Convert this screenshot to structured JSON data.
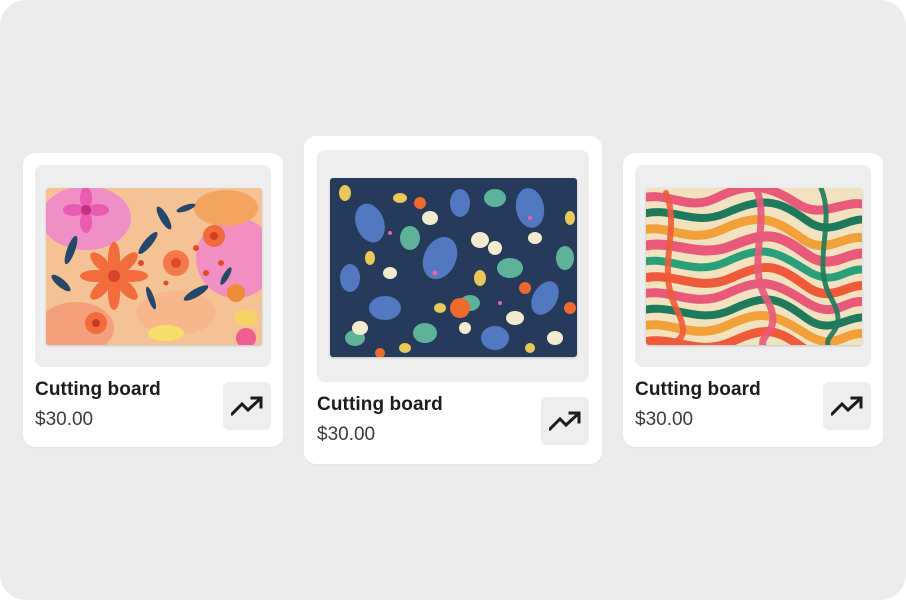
{
  "products": [
    {
      "title": "Cutting board",
      "price": "$30.00",
      "pattern_icon": "floral-peach-pattern"
    },
    {
      "title": "Cutting board",
      "price": "$30.00",
      "pattern_icon": "floral-navy-pattern"
    },
    {
      "title": "Cutting board",
      "price": "$30.00",
      "pattern_icon": "wavy-stripes-pattern"
    }
  ],
  "action_icon": "trending-up-icon",
  "colors": {
    "background": "#ececec",
    "card": "#ffffff",
    "image_frame": "#eeeeee",
    "text_primary": "#1c1c1c",
    "text_secondary": "#3c3c3c"
  }
}
